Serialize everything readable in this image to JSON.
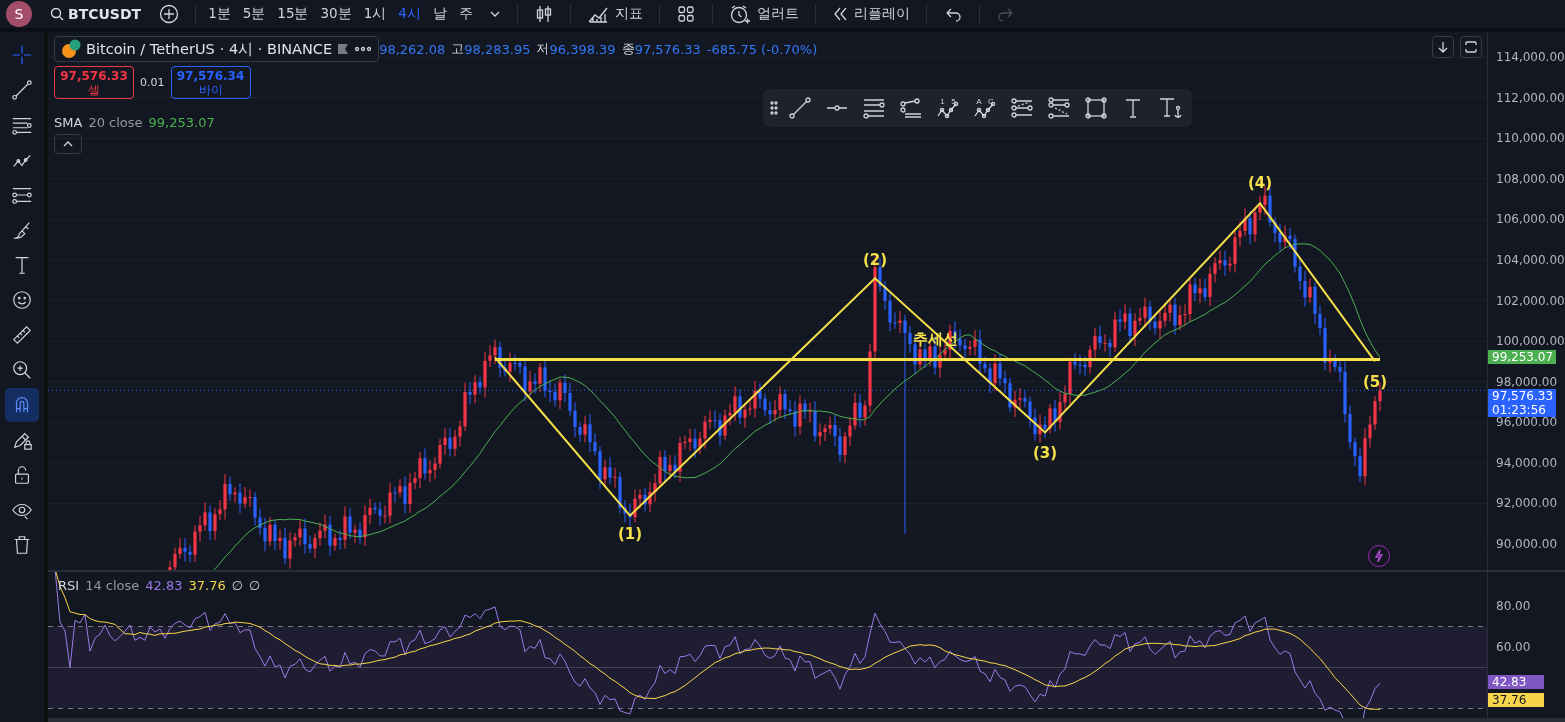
{
  "top_bar": {
    "avatar": "S",
    "symbol": "BTCUSDT",
    "intervals": [
      {
        "label": "1분",
        "selected": false
      },
      {
        "label": "5분",
        "selected": false
      },
      {
        "label": "15분",
        "selected": false
      },
      {
        "label": "30분",
        "selected": false
      },
      {
        "label": "1시",
        "selected": false
      },
      {
        "label": "4시",
        "selected": true
      },
      {
        "label": "날",
        "selected": false
      },
      {
        "label": "주",
        "selected": false
      }
    ],
    "tools": [
      {
        "kind": "chart_type",
        "disabled": false
      },
      {
        "kind": "indicators",
        "label": "지표",
        "disabled": false
      },
      {
        "kind": "layouts",
        "disabled": false
      },
      {
        "kind": "alert",
        "label": "얼러트",
        "disabled": false
      },
      {
        "kind": "replay",
        "label": "리플레이",
        "disabled": false
      },
      {
        "kind": "undo",
        "disabled": false
      },
      {
        "kind": "redo",
        "disabled": true
      }
    ]
  },
  "left_toolbar": [
    {
      "kind": "crosshair",
      "selected": true,
      "on": false
    },
    {
      "kind": "trend_line",
      "selected": false,
      "on": false
    },
    {
      "kind": "fib",
      "selected": false,
      "on": false
    },
    {
      "kind": "pattern",
      "selected": false,
      "on": false
    },
    {
      "kind": "channels",
      "selected": false,
      "on": false
    },
    {
      "kind": "brush",
      "selected": false,
      "on": false
    },
    {
      "kind": "text",
      "selected": false,
      "on": false
    },
    {
      "kind": "emoji",
      "selected": false,
      "on": false
    },
    {
      "kind": "ruler",
      "selected": false,
      "on": false
    },
    {
      "kind": "zoom",
      "selected": false,
      "on": false
    },
    {
      "kind": "magnet",
      "selected": false,
      "on": true
    },
    {
      "kind": "lock_drawing",
      "selected": false,
      "on": false
    },
    {
      "kind": "lock",
      "selected": false,
      "on": false
    },
    {
      "kind": "eye",
      "selected": false,
      "on": false
    },
    {
      "kind": "trash",
      "selected": false,
      "on": false
    }
  ],
  "legend": {
    "symbol": "Bitcoin / TetherUS",
    "interval": "· 4시 · BINANCE",
    "ohlc": [
      {
        "value": "98,262.08"
      },
      {
        "label": "고",
        "value": "98,283.95"
      },
      {
        "label": "저",
        "value": "96,398.39"
      },
      {
        "label": "종",
        "value": "97,576.33"
      }
    ],
    "change": "-685.75 (-0.70%)",
    "sell": {
      "price": "97,576.33",
      "label": "셀"
    },
    "spread": "0.01",
    "buy": {
      "price": "97,576.34",
      "label": "바이"
    },
    "sma": {
      "name": "SMA",
      "params": "20 close",
      "value": "99,253.07"
    }
  },
  "drawing_toolbar": [
    {
      "kind": "line"
    },
    {
      "kind": "ray"
    },
    {
      "kind": "parallel"
    },
    {
      "kind": "fib_channel"
    },
    {
      "kind": "wave",
      "caption": "1   5"
    },
    {
      "kind": "wave",
      "caption": "A   C"
    },
    {
      "kind": "pitch"
    },
    {
      "kind": "pitch2"
    },
    {
      "kind": "rect"
    },
    {
      "kind": "text"
    },
    {
      "kind": "anchored_text"
    }
  ],
  "price_pane": {
    "axis_labels": [
      "114,000.00",
      "112,000.00",
      "110,000.00",
      "108,000.00",
      "106,000.00",
      "104,000.00",
      "102,000.00",
      "100,000.00",
      "98,000.00",
      "96,000.00",
      "94,000.00",
      "92,000.00",
      "90,000.00"
    ],
    "wave_labels": [
      "추세선",
      "(1)",
      "(2)",
      "(3)",
      "(4)",
      "(5)"
    ],
    "badges": [
      {
        "kind": "sma",
        "text": "99,253.07",
        "color": "#4caf50"
      },
      {
        "kind": "last",
        "text": "97,576.33",
        "countdown": "01:23:56",
        "color": "#2962ff"
      }
    ]
  },
  "rsi_pane": {
    "name": "RSI",
    "params": "14 close",
    "values": [
      {
        "text": "42.83",
        "color": "#9c7ae6"
      },
      {
        "text": "37.76",
        "color": "#f7d54a"
      },
      {
        "text": "∅"
      },
      {
        "text": "∅"
      }
    ],
    "ticks": [
      "80.00",
      "60.00"
    ],
    "badges": [
      {
        "text": "42.83",
        "color": "#7e57c2"
      },
      {
        "text": "37.76",
        "color": "#f7d54a"
      }
    ]
  }
}
